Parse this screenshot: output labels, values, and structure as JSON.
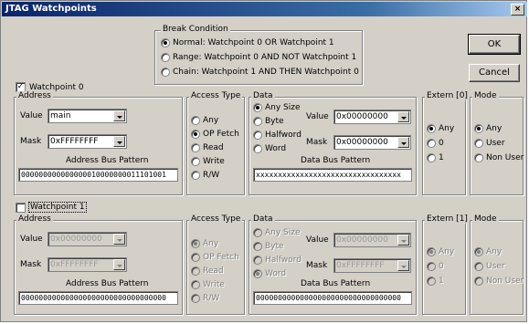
{
  "window": {
    "title": "JTAG Watchpoints",
    "close": "×"
  },
  "buttons": {
    "ok": "OK",
    "cancel": "Cancel"
  },
  "break_condition": {
    "label": "Break Condition",
    "options": [
      {
        "label": "Normal:  Watchpoint 0 OR Watchpoint 1",
        "selected": true
      },
      {
        "label": "Range:  Watchpoint 0 AND NOT Watchpoint 1",
        "selected": false
      },
      {
        "label": "Chain:   Watchpoint 1 AND THEN Watchpoint 0",
        "selected": false
      }
    ]
  },
  "wp0": {
    "checkbox_label": "Watchpoint 0",
    "checked": true,
    "address": {
      "label": "Address",
      "value_label": "Value",
      "value": "main",
      "mask_label": "Mask",
      "mask": "0xFFFFFFFF",
      "pattern_label": "Address Bus Pattern",
      "pattern": "000000000000000010000000011101001"
    },
    "access": {
      "label": "Access Type",
      "options": [
        "Any",
        "OP Fetch",
        "Read",
        "Write",
        "R/W"
      ],
      "selected": 1
    },
    "data": {
      "label": "Data",
      "sizes": [
        "Any Size",
        "Byte",
        "Halfword",
        "Word"
      ],
      "selected": 0,
      "value_label": "Value",
      "value": "0x00000000",
      "mask_label": "Mask",
      "mask": "0x00000000",
      "pattern_label": "Data Bus Pattern",
      "pattern": "xxxxxxxxxxxxxxxxxxxxxxxxxxxxxxxxx"
    },
    "extern": {
      "label": "Extern [0]",
      "options": [
        "Any",
        "0",
        "1"
      ],
      "selected": 0
    },
    "mode": {
      "label": "Mode",
      "options": [
        "Any",
        "User",
        "Non User"
      ],
      "selected": 0
    }
  },
  "wp1": {
    "checkbox_label": "Watchpoint 1",
    "checked": false,
    "address": {
      "label": "Address",
      "value_label": "Value",
      "value": "0x00000000",
      "mask_label": "Mask",
      "mask": "0xFFFFFFFF",
      "pattern_label": "Address Bus Pattern",
      "pattern": "000000000000000000000000000000000"
    },
    "access": {
      "label": "Access Type",
      "options": [
        "Any",
        "OP Fetch",
        "Read",
        "Write",
        "R/W"
      ],
      "selected": 0
    },
    "data": {
      "label": "Data",
      "sizes": [
        "Any Size",
        "Byte",
        "Halfword",
        "Word"
      ],
      "selected": 3,
      "value_label": "Value",
      "value": "0x00000000",
      "mask_label": "Mask",
      "mask": "0xFFFFFFFF",
      "pattern_label": "Data Bus Pattern",
      "pattern": "000000000000000000000000000000000"
    },
    "extern": {
      "label": "Extern [1]",
      "options": [
        "Any",
        "0",
        "1"
      ],
      "selected": 0
    },
    "mode": {
      "label": "Mode",
      "options": [
        "Any",
        "User",
        "Non User"
      ],
      "selected": 0
    }
  }
}
